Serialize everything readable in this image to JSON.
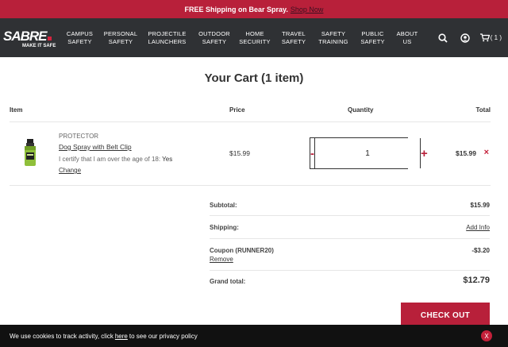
{
  "promo": {
    "text": "FREE Shipping on Bear Spray.",
    "link": "Shop Now"
  },
  "nav": {
    "logo_main": "SABRE",
    "logo_sub": "MAKE IT SAFE",
    "items": [
      {
        "line1": "CAMPUS",
        "line2": "SAFETY"
      },
      {
        "line1": "PERSONAL",
        "line2": "SAFETY"
      },
      {
        "line1": "PROJECTILE",
        "line2": "LAUNCHERS"
      },
      {
        "line1": "OUTDOOR",
        "line2": "SAFETY"
      },
      {
        "line1": "HOME",
        "line2": "SECURITY"
      },
      {
        "line1": "TRAVEL",
        "line2": "SAFETY"
      },
      {
        "line1": "SAFETY",
        "line2": "TRAINING"
      },
      {
        "line1": "PUBLIC",
        "line2": "SAFETY"
      },
      {
        "line1": "ABOUT",
        "line2": "US"
      }
    ],
    "cart_count": "( 1 )",
    "icons": [
      "search-icon",
      "account-icon",
      "cart-icon"
    ]
  },
  "cart": {
    "title": "Your Cart (1 item)",
    "headers": {
      "item": "Item",
      "price": "Price",
      "quantity": "Quantity",
      "total": "Total"
    },
    "line": {
      "brand": "PROTECTOR",
      "name": "Dog Spray with Belt Clip",
      "cert_label": "I certify that I am over the age of 18:",
      "cert_value": "Yes",
      "change": "Change",
      "price": "$15.99",
      "qty": "1",
      "minus": "-",
      "plus": "+",
      "total": "$15.99",
      "remove": "×"
    },
    "summary": {
      "subtotal_label": "Subtotal:",
      "subtotal": "$15.99",
      "shipping_label": "Shipping:",
      "shipping_link": "Add Info",
      "coupon_label": "Coupon (RUNNER20)",
      "coupon_value": "-$3.20",
      "coupon_remove": "Remove",
      "grand_label": "Grand total:",
      "grand_total": "$12.79"
    },
    "checkout": "CHECK OUT"
  },
  "cookie": {
    "text_before": "We use cookies to track activity, click",
    "link": "here",
    "text_after": "to see our privacy policy",
    "close": "X"
  },
  "colors": {
    "brand_red": "#b8203a",
    "nav_bg": "#2f3134",
    "cookie_bg": "#111111"
  }
}
